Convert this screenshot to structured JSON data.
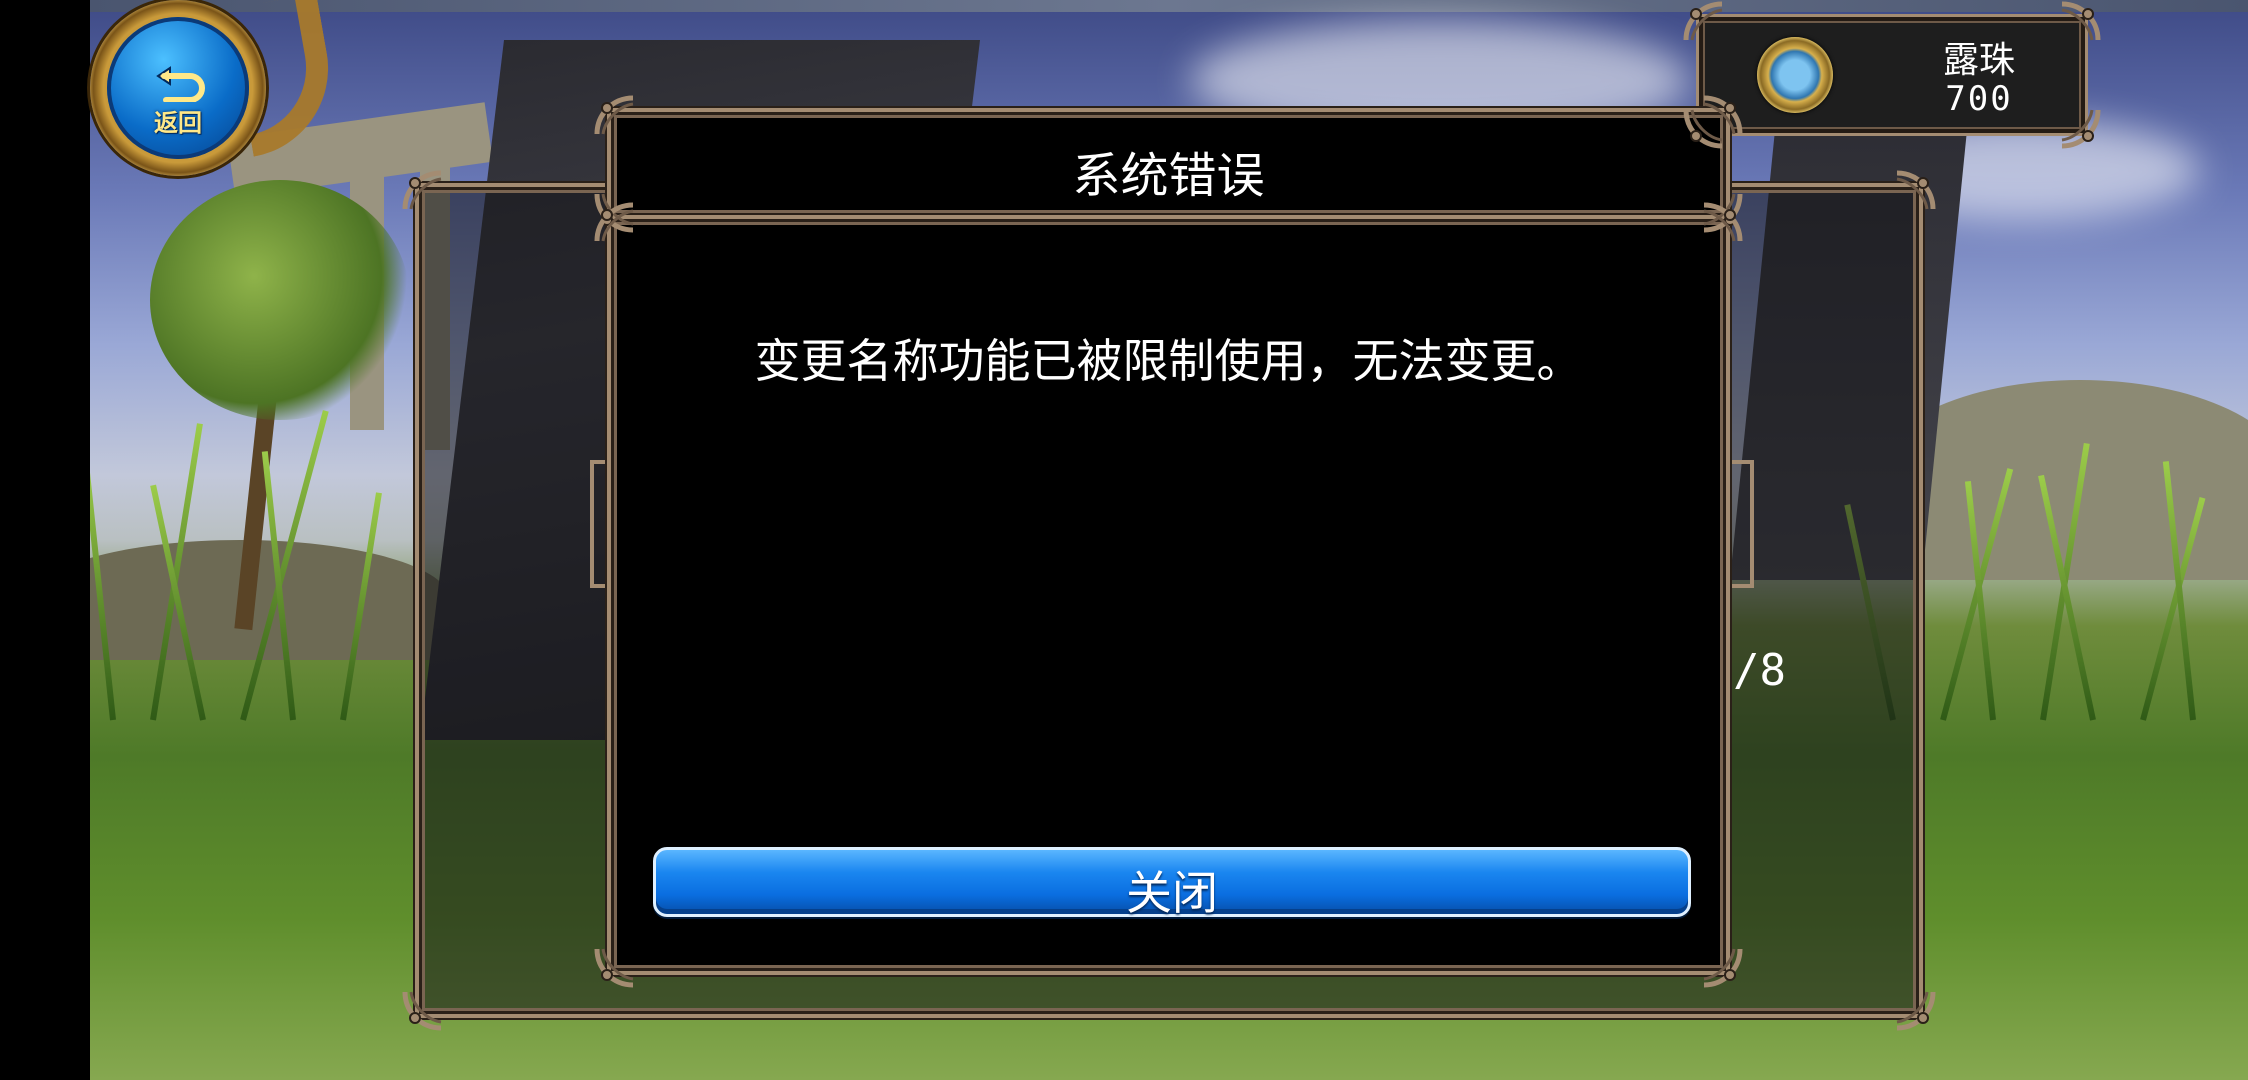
{
  "back_button": {
    "label": "返回",
    "icon": "return-arrow-icon"
  },
  "currency": {
    "name": "露珠",
    "value": "700",
    "icon": "dew-orb-icon"
  },
  "background_panel": {
    "counter": "/8"
  },
  "dialog": {
    "title": "系统错误",
    "message": "变更名称功能已被限制使用，无法变更。",
    "close_label": "关闭"
  },
  "colors": {
    "frame_gold": "#a48c72",
    "dialog_bg": "#000000",
    "button_blue": "#1a86f0",
    "back_button_blue": "#0a6cc8",
    "back_label_yellow": "#ffe888"
  }
}
